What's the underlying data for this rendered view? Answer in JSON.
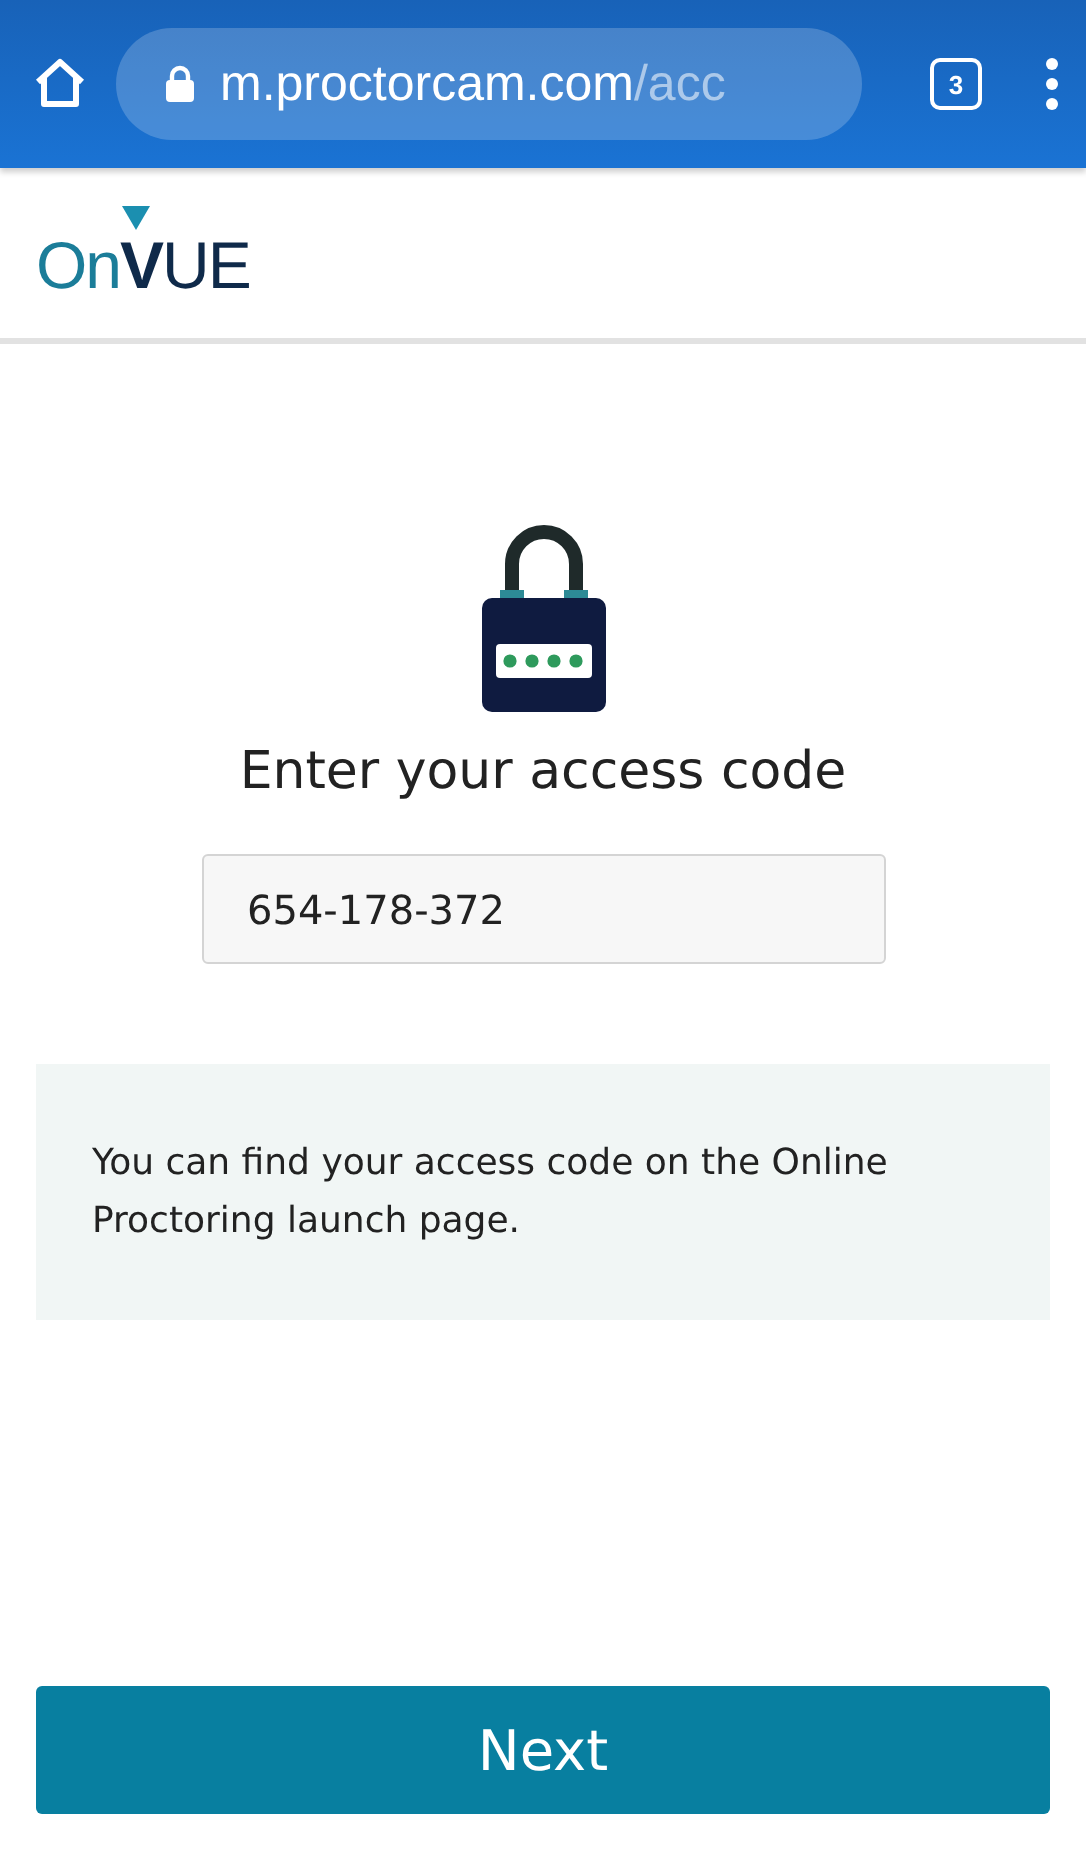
{
  "browser": {
    "url_host": "m.proctorcam.com",
    "url_path": "/acc",
    "tab_count": "3"
  },
  "logo": {
    "parts": [
      "On",
      "V",
      "UE"
    ]
  },
  "heading": "Enter your access code",
  "access_code": {
    "value": "654-178-372"
  },
  "info": "You can find your access code on the Online Proctoring launch page.",
  "next_button": "Next"
}
